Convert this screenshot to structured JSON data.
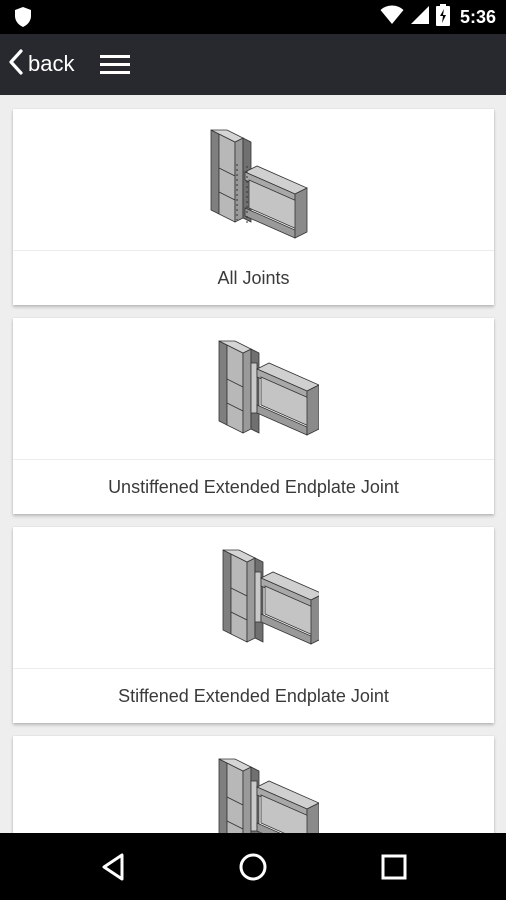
{
  "status_bar": {
    "time": "5:36",
    "icons": [
      "shield-icon",
      "wifi-icon",
      "cell-signal-icon",
      "battery-charging-icon"
    ]
  },
  "app_bar": {
    "back_label": "back",
    "icons": [
      "chevron-left-icon",
      "hamburger-menu-icon"
    ]
  },
  "joints": [
    {
      "label": "All Joints",
      "icon": "all-joints-icon"
    },
    {
      "label": "Unstiffened Extended Endplate Joint",
      "icon": "unstiffened-joint-icon"
    },
    {
      "label": "Stiffened Extended Endplate Joint",
      "icon": "stiffened-joint-icon"
    },
    {
      "label": "",
      "icon": "joint-icon"
    }
  ],
  "nav_bar": {
    "icons": [
      "back-triangle-icon",
      "home-circle-icon",
      "recents-square-icon"
    ]
  },
  "colors": {
    "app_bar": "#27292e",
    "background": "#eeeeee",
    "card": "#ffffff",
    "label_text": "#3a3a3a"
  }
}
